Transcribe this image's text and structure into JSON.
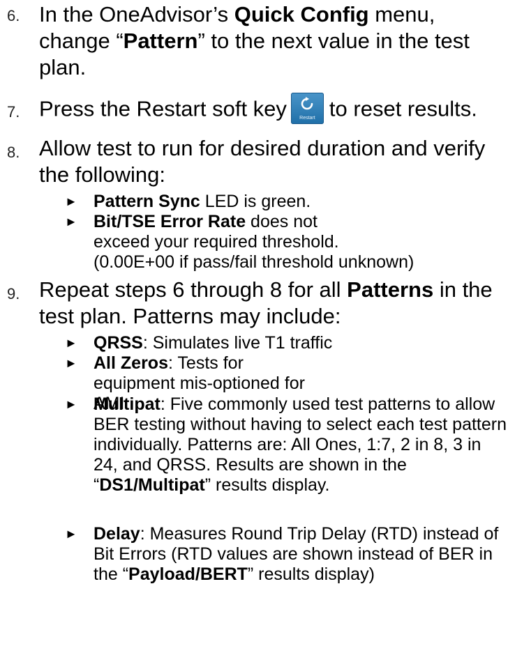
{
  "steps": [
    {
      "num": "6.",
      "parts": [
        {
          "t": "In the OneAdvisor’s "
        },
        {
          "b": "Quick Config"
        },
        {
          "t": " menu, change “"
        },
        {
          "b": "Pattern"
        },
        {
          "t": "” to the next value in the test plan."
        }
      ]
    },
    {
      "num": "7.",
      "pre": "Press the Restart soft key",
      "post": "to reset results.",
      "softkey": {
        "label": "Restart",
        "icon": "refresh-icon",
        "color": "#2a7fbf"
      }
    },
    {
      "num": "8.",
      "text": "Allow test to run for desired duration and verify the following:",
      "bullets": [
        {
          "bold": "Pattern Sync",
          "rest": " LED is green."
        },
        {
          "bold": "Bit/TSE Error Rate",
          "rest": " does not exceed your required threshold.",
          "line3": "(0.00E+00 if pass/fail threshold unknown)"
        }
      ]
    },
    {
      "num": "9.",
      "parts": [
        {
          "t": "Repeat steps 6 through 8 for all "
        },
        {
          "b": "Patterns"
        },
        {
          "t": " in the test plan.  Patterns may include:"
        }
      ],
      "bullets": [
        {
          "bold": "QRSS",
          "rest": ": Simulates live T1 traffic"
        },
        {
          "bold": "All Zeros",
          "rest": ": Tests for equipment mis-optioned for AMI"
        },
        {
          "bold": "Multipat",
          "rest": ": Five commonly used test patterns to allow BER testing without having to select each test pattern individually.  Patterns are: All Ones, 1:7, 2 in 8, 3 in 24, and QRSS. Results are shown in the “",
          "bold2": "DS1/Multipat",
          "rest2": "” results display."
        },
        {
          "bold": "Delay",
          "rest": ": Measures Round Trip Delay (RTD) instead of Bit Errors (RTD values are shown instead of BER in the “",
          "bold2": "Payload/BERT",
          "rest2": "” results display)"
        }
      ]
    }
  ],
  "bullet_glyph": "►"
}
